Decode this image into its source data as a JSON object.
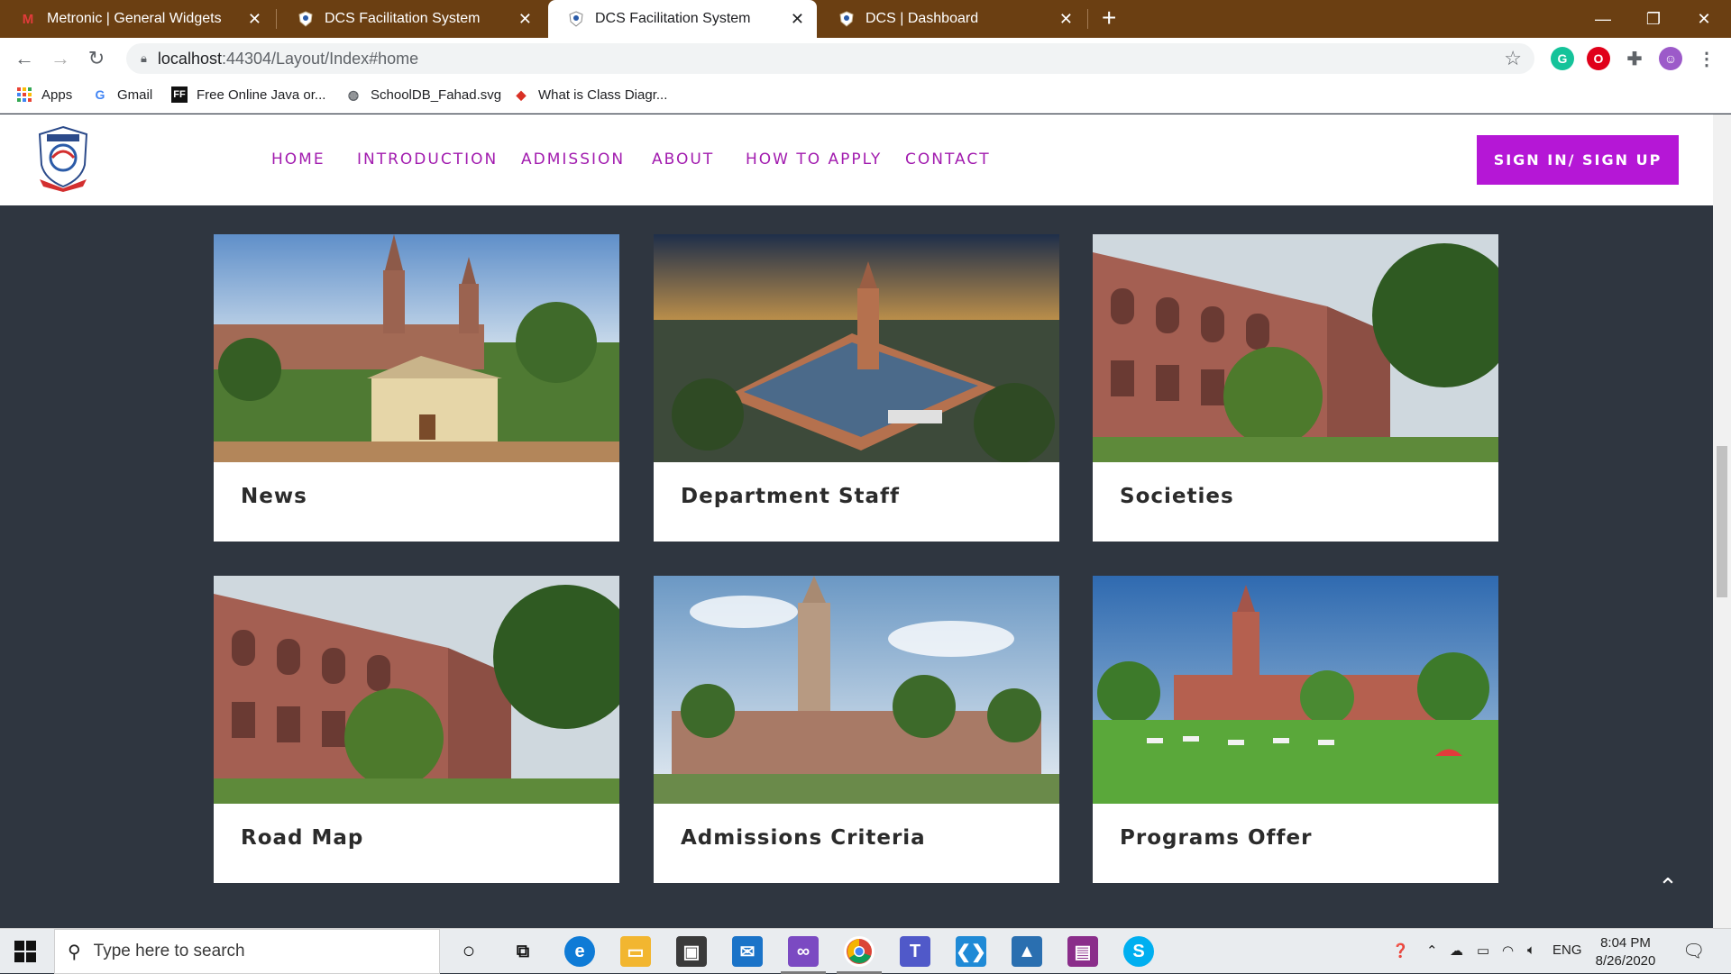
{
  "browser": {
    "tabs": [
      {
        "title": "Metronic | General Widgets",
        "icon": "metronic-icon",
        "active": false
      },
      {
        "title": "DCS Facilitation System",
        "icon": "dcs-shield-icon",
        "active": false
      },
      {
        "title": "DCS Facilitation System",
        "icon": "dcs-shield-icon",
        "active": true
      },
      {
        "title": "DCS | Dashboard",
        "icon": "dcs-shield-icon",
        "active": false
      }
    ],
    "url_host": "localhost",
    "url_path": ":44304/Layout/Index#home",
    "bookmarks": [
      {
        "label": "Apps",
        "icon": "apps-grid-icon"
      },
      {
        "label": "Gmail",
        "icon": "google-icon"
      },
      {
        "label": "Free Online Java or...",
        "icon": "ff-icon"
      },
      {
        "label": "SchoolDB_Fahad.svg",
        "icon": "globe-icon"
      },
      {
        "label": "What is Class Diagr...",
        "icon": "diamond-icon"
      }
    ]
  },
  "site": {
    "nav": [
      {
        "label": "HOME"
      },
      {
        "label": "INTRODUCTION"
      },
      {
        "label": "ADMISSION"
      },
      {
        "label": "ABOUT"
      },
      {
        "label": "HOW TO APPLY"
      },
      {
        "label": "CONTACT"
      }
    ],
    "signin_label": "SIGN IN/ SIGN UP",
    "cards": [
      {
        "label": "News"
      },
      {
        "label": "Department Staff"
      },
      {
        "label": "Societies"
      },
      {
        "label": "Road Map"
      },
      {
        "label": "Admissions Criteria"
      },
      {
        "label": "Programs Offer"
      }
    ],
    "accent_color": "#b517d6",
    "background_color": "#2f3640"
  },
  "taskbar": {
    "search_placeholder": "Type here to search",
    "tray_lang": "ENG",
    "time": "8:04 PM",
    "date": "8/26/2020"
  }
}
